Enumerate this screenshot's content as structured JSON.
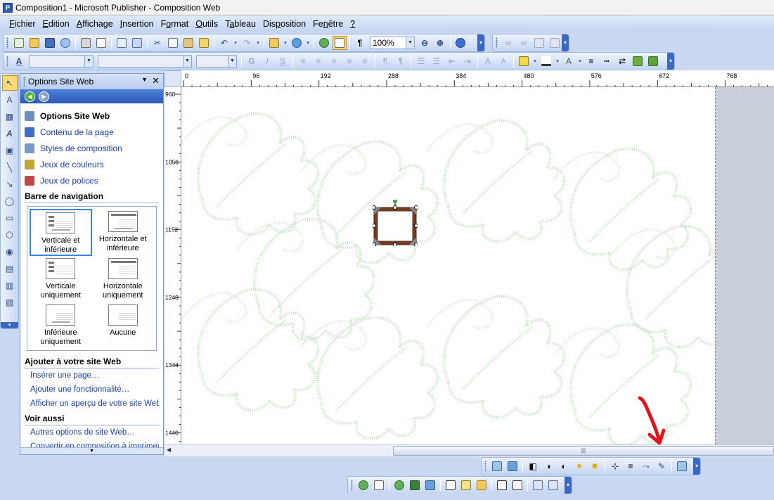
{
  "window": {
    "title": "Composition1 - Microsoft Publisher - Composition Web",
    "app_icon": "publisher-icon"
  },
  "menu": [
    {
      "label": "Fichier",
      "u": "F",
      "rest": "ichier"
    },
    {
      "label": "Edition",
      "u": "E",
      "rest": "dition"
    },
    {
      "label": "Affichage",
      "u": "A",
      "rest": "ffichage"
    },
    {
      "label": "Insertion",
      "u": "I",
      "rest": "nsertion"
    },
    {
      "label": "Format",
      "u": "o",
      "pre": "F",
      "rest": "rmat"
    },
    {
      "label": "Outils",
      "u": "O",
      "rest": "utils"
    },
    {
      "label": "Tableau",
      "u": "a",
      "pre": "T",
      "rest": "bleau"
    },
    {
      "label": "Disposition",
      "u": "p",
      "pre": "Dis",
      "rest": "osition"
    },
    {
      "label": "Fenêtre",
      "u": "n",
      "pre": "Fe",
      "rest": "être"
    },
    {
      "label": "?",
      "u": "?",
      "rest": ""
    }
  ],
  "toolbar_standard": {
    "zoom": "100%"
  },
  "toolbar_formatting": {
    "style": "",
    "font": "",
    "size": ""
  },
  "taskpane": {
    "title": "Options Site Web",
    "links": [
      {
        "label": "Options Site Web",
        "icon": "web-options-icon",
        "color": "#6f8fbf",
        "bold": true
      },
      {
        "label": "Contenu de la page",
        "icon": "page-content-icon",
        "color": "#3d6fc4",
        "bold": false
      },
      {
        "label": "Styles de composition",
        "icon": "design-styles-icon",
        "color": "#7a97cc",
        "bold": false
      },
      {
        "label": "Jeux de couleurs",
        "icon": "color-schemes-icon",
        "color": "#c2a23a",
        "bold": false
      },
      {
        "label": "Jeux de polices",
        "icon": "font-schemes-icon",
        "color": "#c04a4a",
        "bold": false
      }
    ],
    "nav_section": "Barre de navigation",
    "nav_options": [
      {
        "label": "Verticale et inférieure",
        "selected": true,
        "icon": "nav-vertical-bottom-icon"
      },
      {
        "label": "Horizontale et inférieure",
        "selected": false,
        "icon": "nav-horizontal-bottom-icon"
      },
      {
        "label": "Verticale uniquement",
        "selected": false,
        "icon": "nav-vertical-icon"
      },
      {
        "label": "Horizontale uniquement",
        "selected": false,
        "icon": "nav-horizontal-icon"
      },
      {
        "label": "Inférieure uniquement",
        "selected": false,
        "icon": "nav-bottom-icon"
      },
      {
        "label": "Aucune",
        "selected": false,
        "icon": "nav-none-icon"
      }
    ],
    "add_section": "Ajouter à votre site Web",
    "add_links": [
      "Insérer une page…",
      "Ajouter une fonctionnalité…",
      "Afficher un aperçu de votre site Web…"
    ],
    "see_also_section": "Voir aussi",
    "see_also_links": [
      "Autres options de site Web…",
      "Convertir en composition à imprimer"
    ]
  },
  "rulers": {
    "horizontal": [
      "0",
      "96",
      "192",
      "288",
      "384",
      "480",
      "576",
      "672",
      "768"
    ],
    "vertical": [
      "960",
      "1056",
      "1152",
      "1248",
      "1344",
      "1440"
    ]
  },
  "annotation": {
    "color": "#e0151b",
    "description": "red hand-drawn arrow pointing to the bottom toolbar"
  },
  "colors": {
    "accent": "#3a69c4",
    "leaf_pattern": "#bfe0bb",
    "frame": "#7a3b1d"
  }
}
